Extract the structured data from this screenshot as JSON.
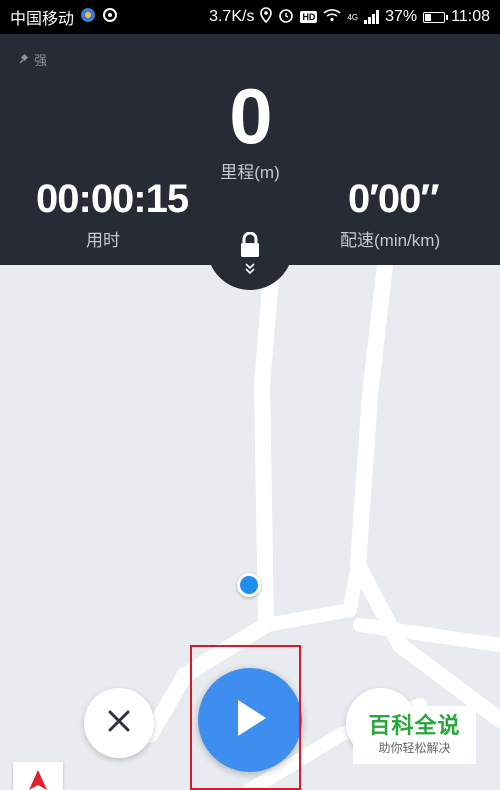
{
  "status_bar": {
    "carrier": "中国移动",
    "speed": "3.7K/s",
    "battery": "37%",
    "battery_level": 0.37,
    "time": "11:08",
    "hd_badge": "HD",
    "network": "4G"
  },
  "stats": {
    "gps_label": "强",
    "distance_value": "0",
    "distance_label": "里程(m)",
    "time_value": "00:00:15",
    "time_label": "用时",
    "pace_value": "0′00″",
    "pace_label": "配速(min/km)"
  },
  "icons": {
    "lock": "lock-icon",
    "expand": "double-chevron-down-icon",
    "close": "close-icon",
    "play": "play-icon",
    "compass": "navigation-arrow-icon"
  },
  "colors": {
    "panel_bg": "#272b36",
    "start_button": "#3e8ef0",
    "location_dot": "#1e8ff0",
    "highlight": "#d7192a",
    "compass_arrow": "#e0202a"
  },
  "watermark": {
    "title": "百科全说",
    "subtitle": "助你轻松解决"
  }
}
